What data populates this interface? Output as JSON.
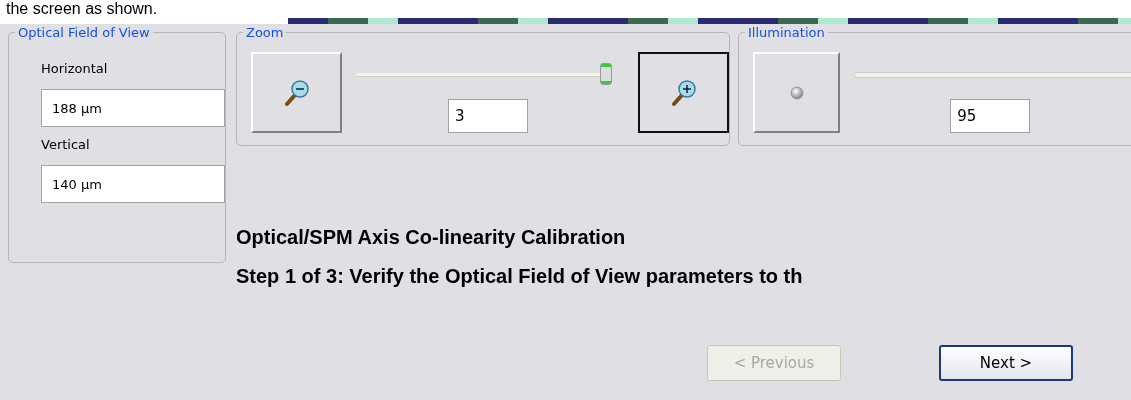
{
  "top_text": "the screen as shown.",
  "field_of_view": {
    "title": "Optical Field of View",
    "fields": [
      {
        "label": "Horizontal",
        "value": "188 µm"
      },
      {
        "label": "Vertical",
        "value": "140 µm"
      }
    ]
  },
  "zoom": {
    "title": "Zoom",
    "buttons": [
      {
        "kind": "zoom-out",
        "focused": false
      },
      {
        "kind": "zoom-in",
        "focused": true
      }
    ],
    "level": 1,
    "value": "3"
  },
  "illumination": {
    "title": "Illumination",
    "value": "95"
  },
  "heading": "Optical/SPM Axis Co-linearity Calibration",
  "step": "Step 1 of 3:  Verify the Optical Field of View parameters to th",
  "buttons": [
    {
      "label": "< Previous",
      "disabled": true,
      "default": false
    },
    {
      "label": "Next >",
      "disabled": false,
      "default": true
    }
  ]
}
